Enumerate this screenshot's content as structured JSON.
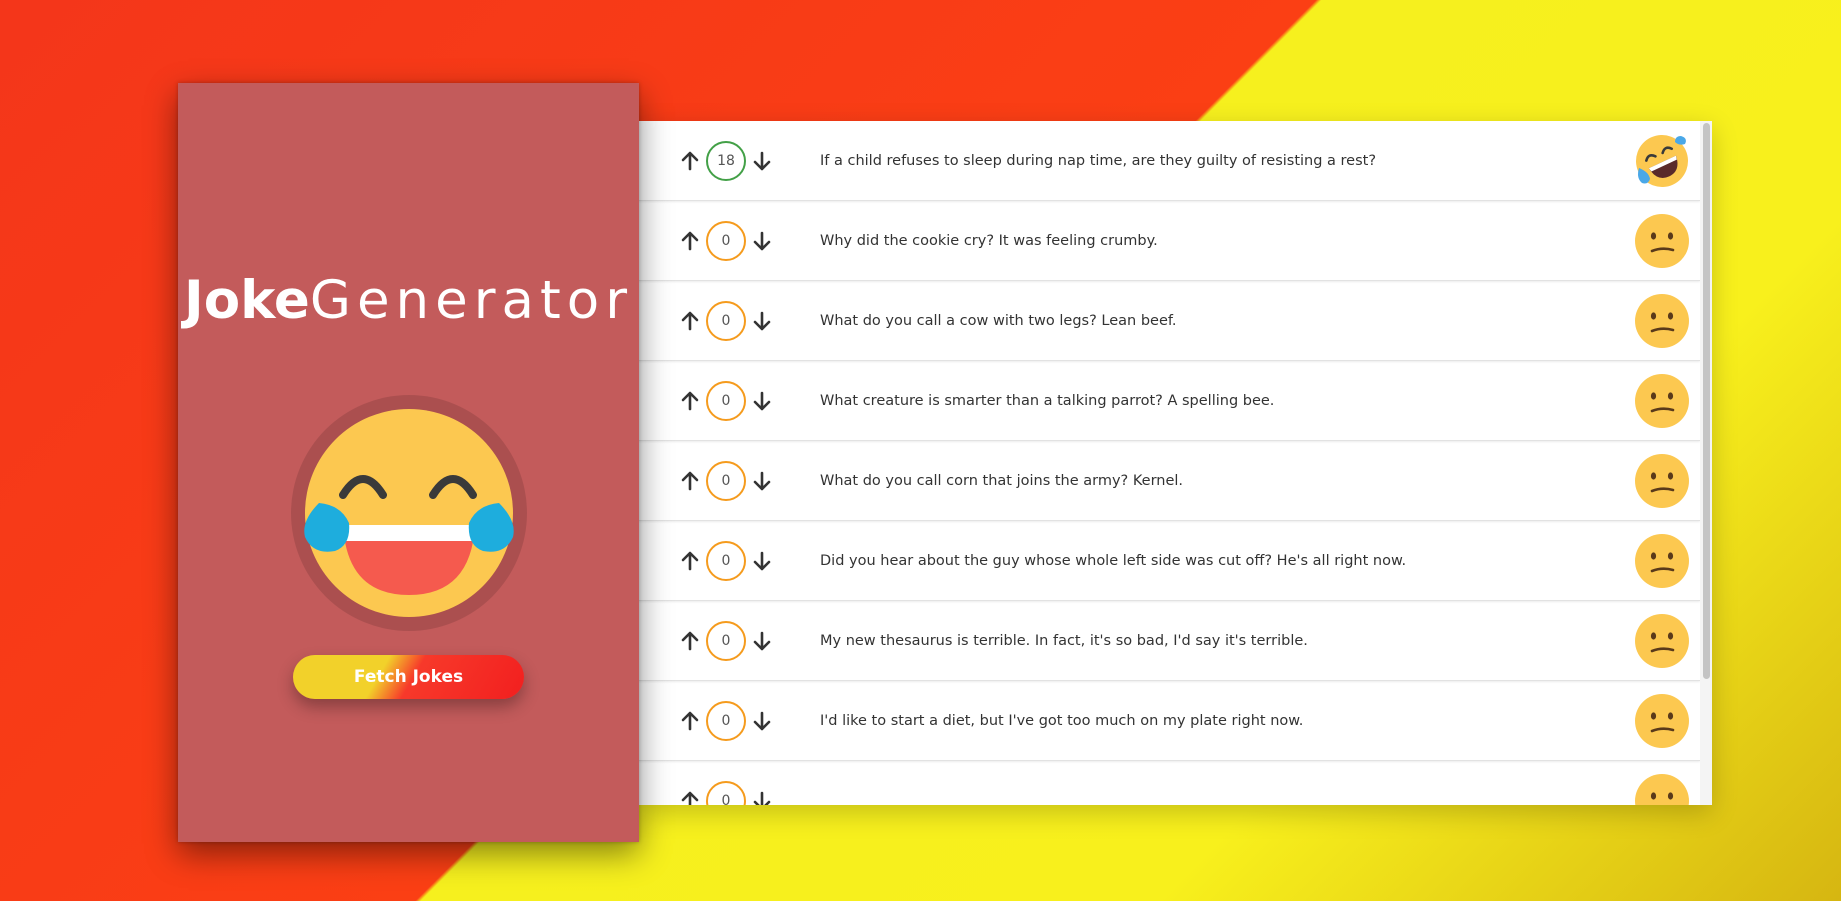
{
  "app": {
    "title_bold": "Joke",
    "title_light": "Generator",
    "fetch_label": "Fetch Jokes"
  },
  "colors": {
    "sidebar": "#c35b5b",
    "positive_border": "#43a047",
    "neutral_border": "#f59b1d",
    "emoji_yellow": "#fcc850"
  },
  "jokes": [
    {
      "votes": "18",
      "text": "If a child refuses to sleep during nap time, are they guilty of resisting a rest?",
      "emoji": "rofl-emoji-icon"
    },
    {
      "votes": "0",
      "text": "Why did the cookie cry? It was feeling crumby.",
      "emoji": "confused-emoji-icon"
    },
    {
      "votes": "0",
      "text": "What do you call a cow with two legs? Lean beef.",
      "emoji": "confused-emoji-icon"
    },
    {
      "votes": "0",
      "text": "What creature is smarter than a talking parrot? A spelling bee.",
      "emoji": "confused-emoji-icon"
    },
    {
      "votes": "0",
      "text": "What do you call corn that joins the army? Kernel.",
      "emoji": "confused-emoji-icon"
    },
    {
      "votes": "0",
      "text": "Did you hear about the guy whose whole left side was cut off? He's all right now.",
      "emoji": "confused-emoji-icon"
    },
    {
      "votes": "0",
      "text": "My new thesaurus is terrible. In fact, it's so bad, I'd say it's terrible.",
      "emoji": "confused-emoji-icon"
    },
    {
      "votes": "0",
      "text": "I'd like to start a diet, but I've got too much on my plate right now.",
      "emoji": "confused-emoji-icon"
    },
    {
      "votes": "0",
      "text": "",
      "emoji": "confused-emoji-icon"
    }
  ]
}
